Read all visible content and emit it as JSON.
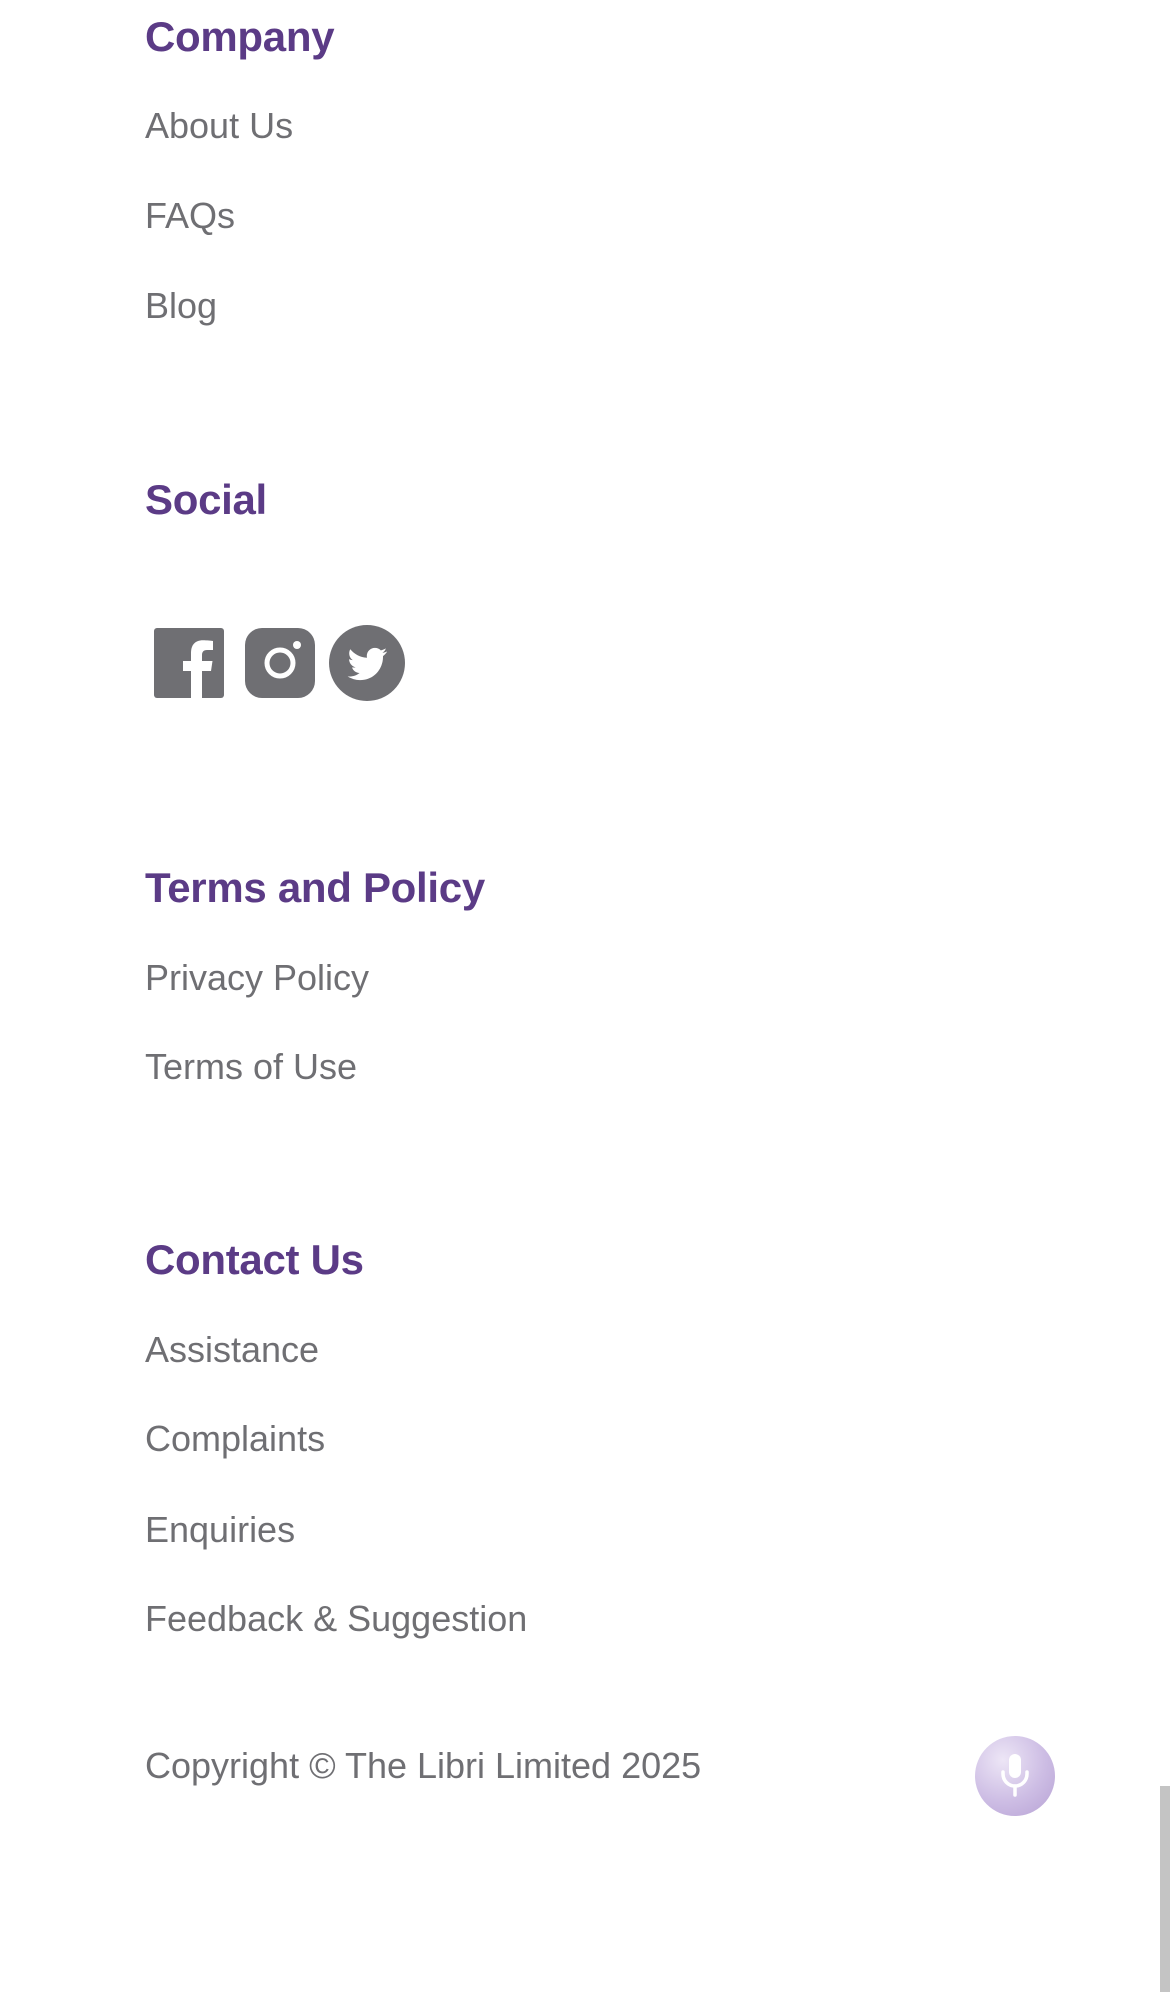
{
  "colors": {
    "heading": "#5b3b86",
    "link": "#6f6f73",
    "icon": "#6f6f73",
    "mic_button": "#c9b9e2"
  },
  "company": {
    "heading": "Company",
    "links": [
      "About Us",
      "FAQs",
      "Blog"
    ]
  },
  "social": {
    "heading": "Social",
    "icons": [
      "facebook-icon",
      "instagram-icon",
      "twitter-icon"
    ]
  },
  "terms": {
    "heading": "Terms and Policy",
    "links": [
      "Privacy Policy",
      "Terms of Use"
    ]
  },
  "contact": {
    "heading": "Contact Us",
    "links": [
      "Assistance",
      "Complaints",
      "Enquiries",
      "Feedback & Suggestion"
    ]
  },
  "footer": {
    "copyright": "Copyright © The Libri Limited 2025",
    "mic_icon": "microphone-icon"
  }
}
